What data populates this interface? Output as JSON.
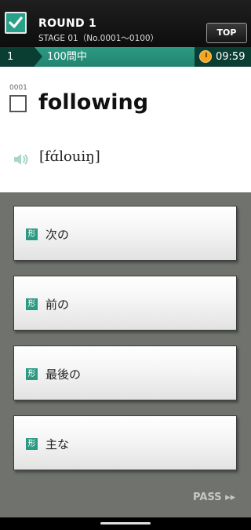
{
  "header": {
    "round_title": "ROUND 1",
    "stage_text": "STAGE 01（No.0001〜0100）",
    "top_label": "TOP"
  },
  "status": {
    "question_index": "1",
    "question_count": "100問中",
    "timer": "09:59"
  },
  "word": {
    "number": "0001",
    "text": "following",
    "pronunciation": "[fɑ́louiŋ]"
  },
  "options": [
    {
      "pos": "形",
      "label": "次の"
    },
    {
      "pos": "形",
      "label": "前の"
    },
    {
      "pos": "形",
      "label": "最後の"
    },
    {
      "pos": "形",
      "label": "主な"
    }
  ],
  "pass_label": "PASS ▸▸",
  "colors": {
    "accent": "#2a9a82",
    "header_bg": "#141414",
    "status_dark": "#0b3e33",
    "timer": "#f4a524"
  }
}
